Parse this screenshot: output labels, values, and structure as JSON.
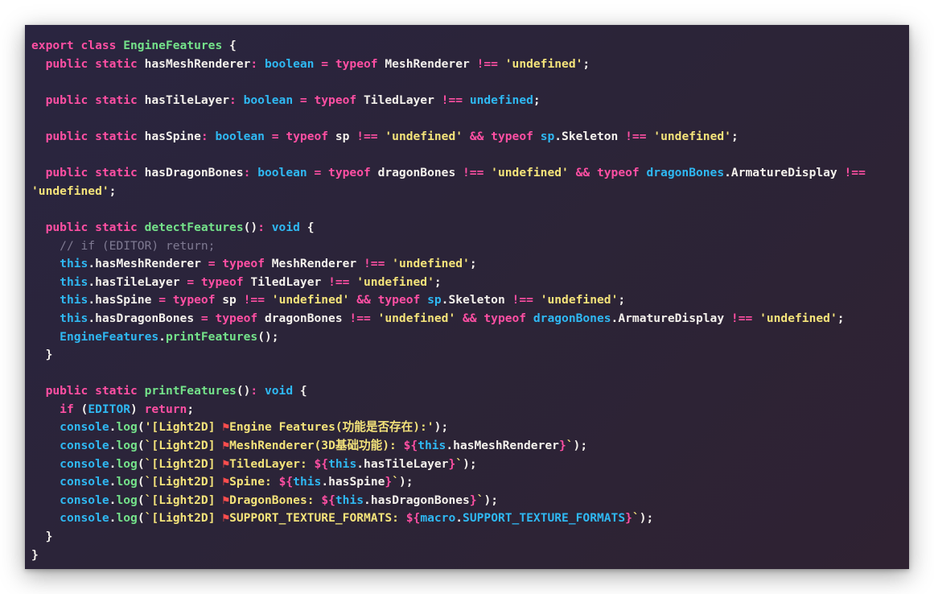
{
  "colors": {
    "background_start": "#2a2540",
    "background_end": "#2f2232",
    "keyword": "#ff4fa3",
    "type": "#2fb8f2",
    "string": "#f4e37a",
    "function": "#74e28a",
    "comment": "#7f7a92",
    "plain": "#f4f1ec",
    "flag_emoji": "#ff4d4d"
  },
  "code_lines": [
    [
      [
        "kw",
        "export class "
      ],
      [
        "fn",
        "EngineFeatures"
      ],
      [
        "plain",
        " {"
      ]
    ],
    [
      [
        "plain",
        "  "
      ],
      [
        "kw",
        "public static "
      ],
      [
        "plain",
        "hasMeshRenderer"
      ],
      [
        "kw",
        ": "
      ],
      [
        "type",
        "boolean"
      ],
      [
        "kw",
        " = typeof "
      ],
      [
        "plain",
        "MeshRenderer "
      ],
      [
        "kw",
        "!== "
      ],
      [
        "str",
        "'undefined'"
      ],
      [
        "plain",
        ";"
      ]
    ],
    [],
    [
      [
        "plain",
        "  "
      ],
      [
        "kw",
        "public static "
      ],
      [
        "plain",
        "hasTileLayer"
      ],
      [
        "kw",
        ": "
      ],
      [
        "type",
        "boolean"
      ],
      [
        "kw",
        " = typeof "
      ],
      [
        "plain",
        "TiledLayer "
      ],
      [
        "kw",
        "!== "
      ],
      [
        "type",
        "undefined"
      ],
      [
        "plain",
        ";"
      ]
    ],
    [],
    [
      [
        "plain",
        "  "
      ],
      [
        "kw",
        "public static "
      ],
      [
        "plain",
        "hasSpine"
      ],
      [
        "kw",
        ": "
      ],
      [
        "type",
        "boolean"
      ],
      [
        "kw",
        " = typeof "
      ],
      [
        "plain",
        "sp "
      ],
      [
        "kw",
        "!== "
      ],
      [
        "str",
        "'undefined'"
      ],
      [
        "kw",
        " && typeof "
      ],
      [
        "type",
        "sp"
      ],
      [
        "plain",
        ".Skeleton "
      ],
      [
        "kw",
        "!== "
      ],
      [
        "str",
        "'undefined'"
      ],
      [
        "plain",
        ";"
      ]
    ],
    [],
    [
      [
        "plain",
        "  "
      ],
      [
        "kw",
        "public static "
      ],
      [
        "plain",
        "hasDragonBones"
      ],
      [
        "kw",
        ": "
      ],
      [
        "type",
        "boolean"
      ],
      [
        "kw",
        " = typeof "
      ],
      [
        "plain",
        "dragonBones "
      ],
      [
        "kw",
        "!== "
      ],
      [
        "str",
        "'undefined'"
      ],
      [
        "kw",
        " && typeof "
      ],
      [
        "type",
        "dragonBones"
      ],
      [
        "plain",
        ".ArmatureDisplay "
      ],
      [
        "kw",
        "!=="
      ]
    ],
    [
      [
        "str",
        "'undefined'"
      ],
      [
        "plain",
        ";"
      ]
    ],
    [],
    [
      [
        "plain",
        "  "
      ],
      [
        "kw",
        "public static "
      ],
      [
        "fn",
        "detectFeatures"
      ],
      [
        "plain",
        "()"
      ],
      [
        "kw",
        ": "
      ],
      [
        "type",
        "void"
      ],
      [
        "plain",
        " {"
      ]
    ],
    [
      [
        "plain",
        "    "
      ],
      [
        "cmt",
        "// if (EDITOR) return;"
      ]
    ],
    [
      [
        "plain",
        "    "
      ],
      [
        "type",
        "this"
      ],
      [
        "plain",
        ".hasMeshRenderer "
      ],
      [
        "kw",
        "= typeof "
      ],
      [
        "plain",
        "MeshRenderer "
      ],
      [
        "kw",
        "!== "
      ],
      [
        "str",
        "'undefined'"
      ],
      [
        "plain",
        ";"
      ]
    ],
    [
      [
        "plain",
        "    "
      ],
      [
        "type",
        "this"
      ],
      [
        "plain",
        ".hasTileLayer "
      ],
      [
        "kw",
        "= typeof "
      ],
      [
        "plain",
        "TiledLayer "
      ],
      [
        "kw",
        "!== "
      ],
      [
        "str",
        "'undefined'"
      ],
      [
        "plain",
        ";"
      ]
    ],
    [
      [
        "plain",
        "    "
      ],
      [
        "type",
        "this"
      ],
      [
        "plain",
        ".hasSpine "
      ],
      [
        "kw",
        "= typeof "
      ],
      [
        "plain",
        "sp "
      ],
      [
        "kw",
        "!== "
      ],
      [
        "str",
        "'undefined'"
      ],
      [
        "kw",
        " && typeof "
      ],
      [
        "type",
        "sp"
      ],
      [
        "plain",
        ".Skeleton "
      ],
      [
        "kw",
        "!== "
      ],
      [
        "str",
        "'undefined'"
      ],
      [
        "plain",
        ";"
      ]
    ],
    [
      [
        "plain",
        "    "
      ],
      [
        "type",
        "this"
      ],
      [
        "plain",
        ".hasDragonBones "
      ],
      [
        "kw",
        "= typeof "
      ],
      [
        "plain",
        "dragonBones "
      ],
      [
        "kw",
        "!== "
      ],
      [
        "str",
        "'undefined'"
      ],
      [
        "kw",
        " && typeof "
      ],
      [
        "type",
        "dragonBones"
      ],
      [
        "plain",
        ".ArmatureDisplay "
      ],
      [
        "kw",
        "!== "
      ],
      [
        "str",
        "'undefined'"
      ],
      [
        "plain",
        ";"
      ]
    ],
    [
      [
        "plain",
        "    "
      ],
      [
        "type",
        "EngineFeatures"
      ],
      [
        "plain",
        "."
      ],
      [
        "fn",
        "printFeatures"
      ],
      [
        "plain",
        "();"
      ]
    ],
    [
      [
        "plain",
        "  }"
      ]
    ],
    [],
    [
      [
        "plain",
        "  "
      ],
      [
        "kw",
        "public static "
      ],
      [
        "fn",
        "printFeatures"
      ],
      [
        "plain",
        "()"
      ],
      [
        "kw",
        ": "
      ],
      [
        "type",
        "void"
      ],
      [
        "plain",
        " {"
      ]
    ],
    [
      [
        "plain",
        "    "
      ],
      [
        "kw",
        "if "
      ],
      [
        "plain",
        "("
      ],
      [
        "type",
        "EDITOR"
      ],
      [
        "plain",
        ") "
      ],
      [
        "kw",
        "return"
      ],
      [
        "plain",
        ";"
      ]
    ],
    [
      [
        "plain",
        "    "
      ],
      [
        "type",
        "console"
      ],
      [
        "plain",
        "."
      ],
      [
        "fn",
        "log"
      ],
      [
        "plain",
        "("
      ],
      [
        "str",
        "'[Light2D] "
      ],
      [
        "flag",
        "⚑"
      ],
      [
        "str",
        "Engine Features(功能是否存在):'"
      ],
      [
        "plain",
        ");"
      ]
    ],
    [
      [
        "plain",
        "    "
      ],
      [
        "type",
        "console"
      ],
      [
        "plain",
        "."
      ],
      [
        "fn",
        "log"
      ],
      [
        "plain",
        "("
      ],
      [
        "str",
        "`[Light2D] "
      ],
      [
        "flag",
        "⚑"
      ],
      [
        "str",
        "MeshRenderer(3D基础功能): "
      ],
      [
        "kw",
        "${"
      ],
      [
        "type",
        "this"
      ],
      [
        "plain",
        ".hasMeshRenderer"
      ],
      [
        "kw",
        "}"
      ],
      [
        "str",
        "`"
      ],
      [
        "plain",
        ");"
      ]
    ],
    [
      [
        "plain",
        "    "
      ],
      [
        "type",
        "console"
      ],
      [
        "plain",
        "."
      ],
      [
        "fn",
        "log"
      ],
      [
        "plain",
        "("
      ],
      [
        "str",
        "`[Light2D] "
      ],
      [
        "flag",
        "⚑"
      ],
      [
        "str",
        "TiledLayer: "
      ],
      [
        "kw",
        "${"
      ],
      [
        "type",
        "this"
      ],
      [
        "plain",
        ".hasTileLayer"
      ],
      [
        "kw",
        "}"
      ],
      [
        "str",
        "`"
      ],
      [
        "plain",
        ");"
      ]
    ],
    [
      [
        "plain",
        "    "
      ],
      [
        "type",
        "console"
      ],
      [
        "plain",
        "."
      ],
      [
        "fn",
        "log"
      ],
      [
        "plain",
        "("
      ],
      [
        "str",
        "`[Light2D] "
      ],
      [
        "flag",
        "⚑"
      ],
      [
        "str",
        "Spine: "
      ],
      [
        "kw",
        "${"
      ],
      [
        "type",
        "this"
      ],
      [
        "plain",
        ".hasSpine"
      ],
      [
        "kw",
        "}"
      ],
      [
        "str",
        "`"
      ],
      [
        "plain",
        ");"
      ]
    ],
    [
      [
        "plain",
        "    "
      ],
      [
        "type",
        "console"
      ],
      [
        "plain",
        "."
      ],
      [
        "fn",
        "log"
      ],
      [
        "plain",
        "("
      ],
      [
        "str",
        "`[Light2D] "
      ],
      [
        "flag",
        "⚑"
      ],
      [
        "str",
        "DragonBones: "
      ],
      [
        "kw",
        "${"
      ],
      [
        "type",
        "this"
      ],
      [
        "plain",
        ".hasDragonBones"
      ],
      [
        "kw",
        "}"
      ],
      [
        "str",
        "`"
      ],
      [
        "plain",
        ");"
      ]
    ],
    [
      [
        "plain",
        "    "
      ],
      [
        "type",
        "console"
      ],
      [
        "plain",
        "."
      ],
      [
        "fn",
        "log"
      ],
      [
        "plain",
        "("
      ],
      [
        "str",
        "`[Light2D] "
      ],
      [
        "flag",
        "⚑"
      ],
      [
        "str",
        "SUPPORT_TEXTURE_FORMATS: "
      ],
      [
        "kw",
        "${"
      ],
      [
        "type",
        "macro"
      ],
      [
        "plain",
        "."
      ],
      [
        "type",
        "SUPPORT_TEXTURE_FORMATS"
      ],
      [
        "kw",
        "}"
      ],
      [
        "str",
        "`"
      ],
      [
        "plain",
        ");"
      ]
    ],
    [
      [
        "plain",
        "  }"
      ]
    ],
    [
      [
        "plain",
        "}"
      ]
    ]
  ]
}
